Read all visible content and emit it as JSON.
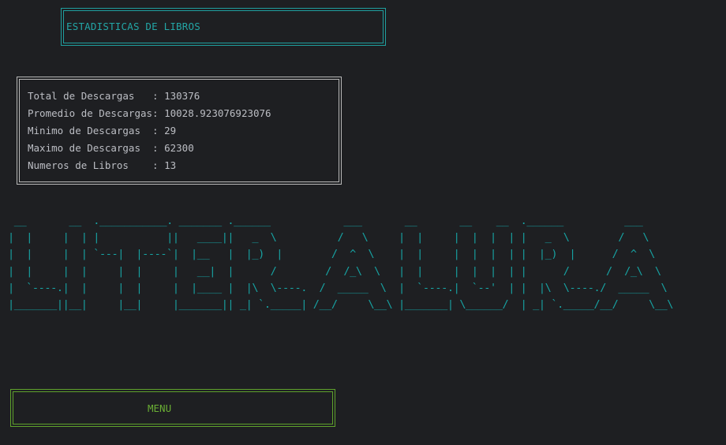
{
  "colors": {
    "background": "#1e1f22",
    "title_accent": "#1f9f9f",
    "stats_border": "#b8b8b8",
    "text": "#bcbec4",
    "ascii_art": "#17a2a2",
    "menu_accent": "#5fa22c"
  },
  "title": "ESTADISTICAS DE LIBROS",
  "stats": [
    {
      "label": "Total de Descargas   ",
      "value": "130376"
    },
    {
      "label": "Promedio de Descargas",
      "value": "10028.923076923076"
    },
    {
      "label": "Minimo de Descargas  ",
      "value": "29"
    },
    {
      "label": "Maximo de Descargas  ",
      "value": "62300"
    },
    {
      "label": "Numeros de Libros    ",
      "value": "13"
    }
  ],
  "banner": "LITER ALURA",
  "menu_label": "MENU"
}
